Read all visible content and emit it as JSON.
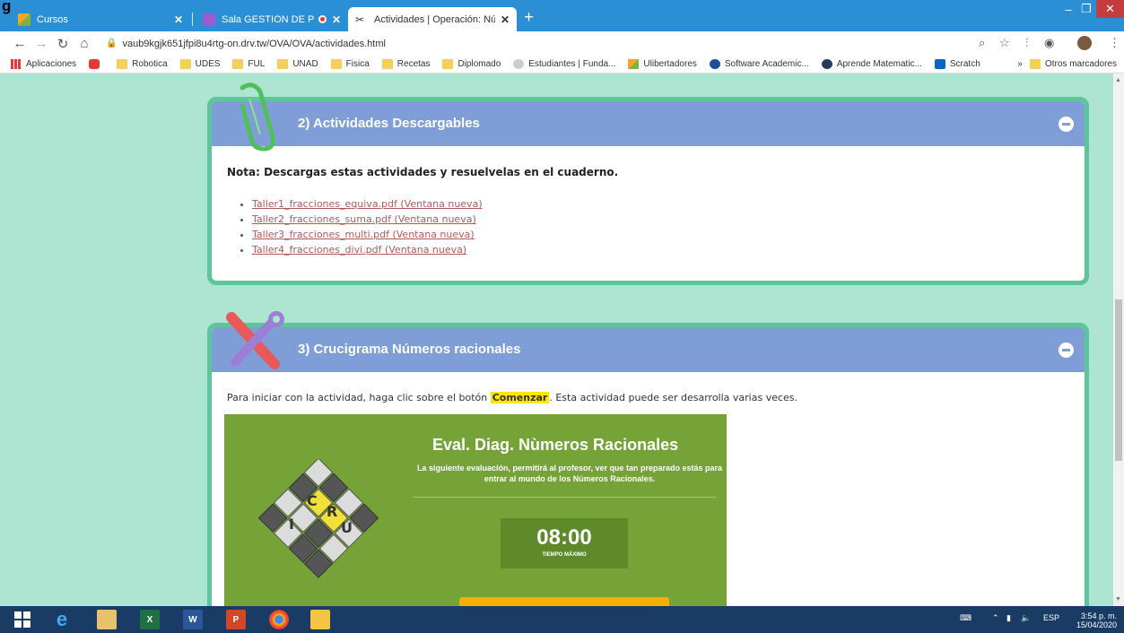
{
  "window": {
    "corner_text": "g",
    "tabs": [
      {
        "title": "Cursos",
        "active": false
      },
      {
        "title": "Sala GESTIÓN DE PROYECTO",
        "active": false
      },
      {
        "title": "Actividades | Operación: Número",
        "active": true
      }
    ]
  },
  "address_bar": {
    "url": "vaub9kgjk651jfpi8u4rtg-on.drv.tw/OVA/OVA/actividades.html"
  },
  "bookmarks": [
    {
      "label": "Aplicaciones",
      "icon": "apps-grid-icon"
    },
    {
      "label": "",
      "icon": "youtube-icon"
    },
    {
      "label": "Robotica",
      "icon": "folder-icon"
    },
    {
      "label": "UDES",
      "icon": "folder-icon"
    },
    {
      "label": "FUL",
      "icon": "folder-icon"
    },
    {
      "label": "UNAD",
      "icon": "folder-icon"
    },
    {
      "label": "Fisica",
      "icon": "folder-icon"
    },
    {
      "label": "Recetas",
      "icon": "folder-icon"
    },
    {
      "label": "Diplomado",
      "icon": "folder-icon"
    },
    {
      "label": "Estudiantes | Funda...",
      "icon": "site-icon"
    },
    {
      "label": "Ulibertadores",
      "icon": "site-icon"
    },
    {
      "label": "Software Academic...",
      "icon": "site-icon"
    },
    {
      "label": "Aprende Matematic...",
      "icon": "site-icon"
    },
    {
      "label": "Scratch",
      "icon": "linkedin-icon"
    }
  ],
  "bookmarks_more": "»",
  "bookmarks_other": "Otros marcadores",
  "section2": {
    "title": "2) Actividades Descargables",
    "note": "Nota: Descargas estas actividades y resuelvelas en el cuaderno.",
    "links": [
      "Taller1_fracciones_equiva.pdf (Ventana nueva)",
      "Taller2_fracciones_suma.pdf (Ventana nueva)",
      "Taller3_fracciones_multi.pdf (Ventana nueva)",
      "Taller4_fracciones_divi.pdf (Ventana nueva)"
    ]
  },
  "section3": {
    "title": "3) Crucigrama Números racionales",
    "intro_before": "Para iniciar con la actividad, haga clic sobre el botón ",
    "intro_highlight": "Comenzar",
    "intro_after": ". Esta actividad puede ser desarrolla varias veces.",
    "quiz": {
      "title": "Eval. Diag. Nùmeros Racionales",
      "description": "La siguiente evaluación, permitirá al profesor, ver que tan preparado estás para entrar al mundo de los Números Racionales.",
      "timer_value": "08:00",
      "timer_label": "TIEMPO MÁXIMO",
      "logo_letters": [
        "C",
        "R",
        "U",
        "I"
      ]
    }
  },
  "taskbar": {
    "language": "ESP",
    "time": "3:54 p. m.",
    "date": "15/04/2020"
  }
}
